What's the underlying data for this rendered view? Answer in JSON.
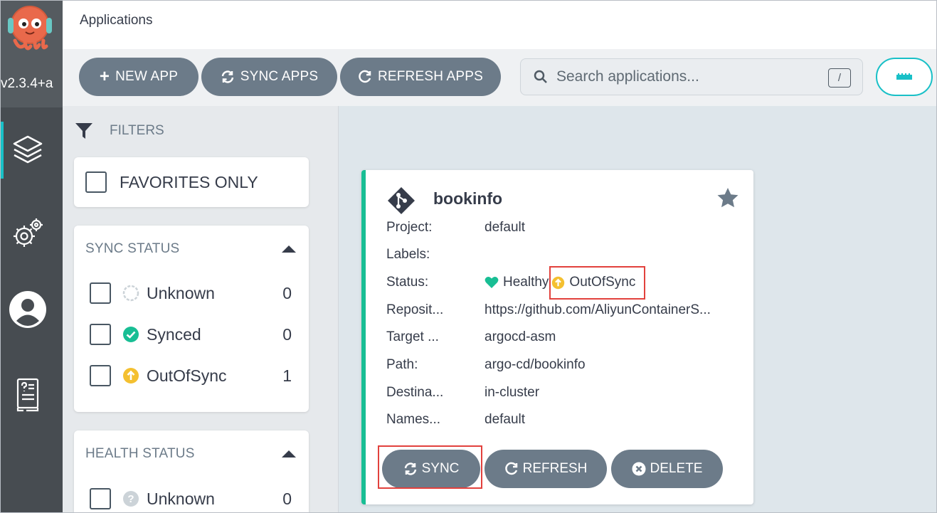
{
  "nav": {
    "version": "v2.3.4+a",
    "items": [
      {
        "icon": "applications-layers-icon"
      },
      {
        "icon": "settings-gears-icon"
      },
      {
        "icon": "user-info-icon"
      },
      {
        "icon": "documentation-icon"
      }
    ]
  },
  "topbar": {
    "title": "Applications"
  },
  "toolbar": {
    "new_app": "NEW APP",
    "sync_apps": "SYNC APPS",
    "refresh_apps": "REFRESH APPS",
    "search_placeholder": "Search applications...",
    "search_shortcut": "/"
  },
  "filters": {
    "title": "FILTERS",
    "favorites_only": "FAVORITES ONLY",
    "sync_status": {
      "title": "SYNC STATUS",
      "items": [
        {
          "label": "Unknown",
          "count": "0"
        },
        {
          "label": "Synced",
          "count": "0"
        },
        {
          "label": "OutOfSync",
          "count": "1"
        }
      ]
    },
    "health_status": {
      "title": "HEALTH STATUS",
      "items": [
        {
          "label": "Unknown",
          "count": "0"
        }
      ]
    }
  },
  "app": {
    "name": "bookinfo",
    "fields": [
      {
        "key": "Project:",
        "value": "default"
      },
      {
        "key": "Labels:",
        "value": ""
      },
      {
        "key": "Status:",
        "health": "Healthy",
        "sync": "OutOfSync"
      },
      {
        "key": "Reposit...",
        "value": "https://github.com/AliyunContainerS..."
      },
      {
        "key": "Target ...",
        "value": "argocd-asm"
      },
      {
        "key": "Path:",
        "value": "argo-cd/bookinfo"
      },
      {
        "key": "Destina...",
        "value": "in-cluster"
      },
      {
        "key": "Names...",
        "value": "default"
      }
    ],
    "actions": {
      "sync": "SYNC",
      "refresh": "REFRESH",
      "delete": "DELETE"
    }
  },
  "colors": {
    "accent": "#19c0c7",
    "healthy": "#18be94",
    "out_of_sync": "#f4c030",
    "button": "#6c7b89",
    "highlight": "#e2413d"
  }
}
